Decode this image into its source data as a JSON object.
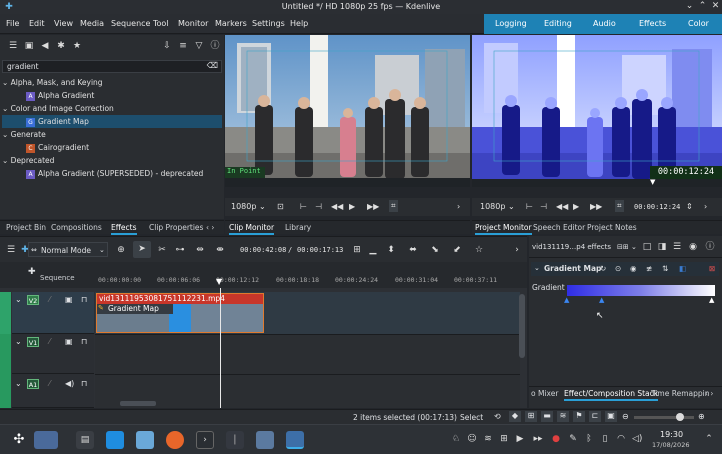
{
  "window": {
    "title": "Untitled */ HD 1080p 25 fps — Kdenlive"
  },
  "menu": [
    "File",
    "Edit",
    "View",
    "Media",
    "Sequence",
    "Tool",
    "Monitor",
    "Markers",
    "Settings",
    "Help"
  ],
  "workspaces": [
    "Logging",
    "Editing",
    "Audio",
    "Effects",
    "Color"
  ],
  "effects_panel": {
    "search_value": "gradient",
    "tree": [
      {
        "type": "category",
        "label": "Alpha, Mask, and Keying"
      },
      {
        "type": "item",
        "badge": "A",
        "label": "Alpha Gradient",
        "color": "#6b5bc4"
      },
      {
        "type": "category",
        "label": "Color and Image Correction"
      },
      {
        "type": "item",
        "badge": "G",
        "label": "Gradient Map",
        "color": "#3a6fd8",
        "selected": true
      },
      {
        "type": "category",
        "label": "Generate"
      },
      {
        "type": "item",
        "badge": "C",
        "label": "Cairogradient",
        "color": "#c0552a"
      },
      {
        "type": "category",
        "label": "Deprecated"
      },
      {
        "type": "item",
        "badge": "A",
        "label": "Alpha Gradient (SUPERSEDED) - deprecated",
        "color": "#6b5bc4"
      }
    ],
    "tabs": [
      "Project Bin",
      "Compositions",
      "Effects",
      "Clip Properties"
    ]
  },
  "clip_monitor": {
    "overlay_label": "In Point",
    "zoom": "1080p",
    "tabs": [
      "Clip Monitor",
      "Library"
    ]
  },
  "project_monitor": {
    "timecode": "00:00:12:24",
    "zoom": "1080p",
    "field_timecode": "00:00:12:24",
    "tabs": [
      "Project Monitor",
      "Speech Editor",
      "Project Notes"
    ]
  },
  "timeline_toolbar": {
    "mode": "Normal Mode",
    "position": "00:00:42:08",
    "duration": "00:00:17:13"
  },
  "ruler": {
    "sequence_label": "Sequence",
    "ticks": [
      "00:00:00:00",
      "00:00:06:06",
      "00:00:12:12",
      "00:00:18:18",
      "00:00:24:24",
      "00:00:31:04",
      "00:00:37:11"
    ]
  },
  "tracks": [
    {
      "label": "V2"
    },
    {
      "label": "V1"
    },
    {
      "label": "A1"
    }
  ],
  "clip": {
    "name": "vid13111953081751112231.mp4",
    "effect": "Gradient Map"
  },
  "effect_stack": {
    "header": "vid131119…p4 effects",
    "effect_title": "Gradient Map",
    "param_label": "Gradient",
    "bottom_tabs": [
      "o Mixer",
      "Effect/Composition Stack",
      "Time Remappin"
    ]
  },
  "status": {
    "selection": "2 items selected (00:17:13)",
    "tool": "Select"
  },
  "clock": {
    "time": "19:30",
    "date": "17/08/2026"
  }
}
